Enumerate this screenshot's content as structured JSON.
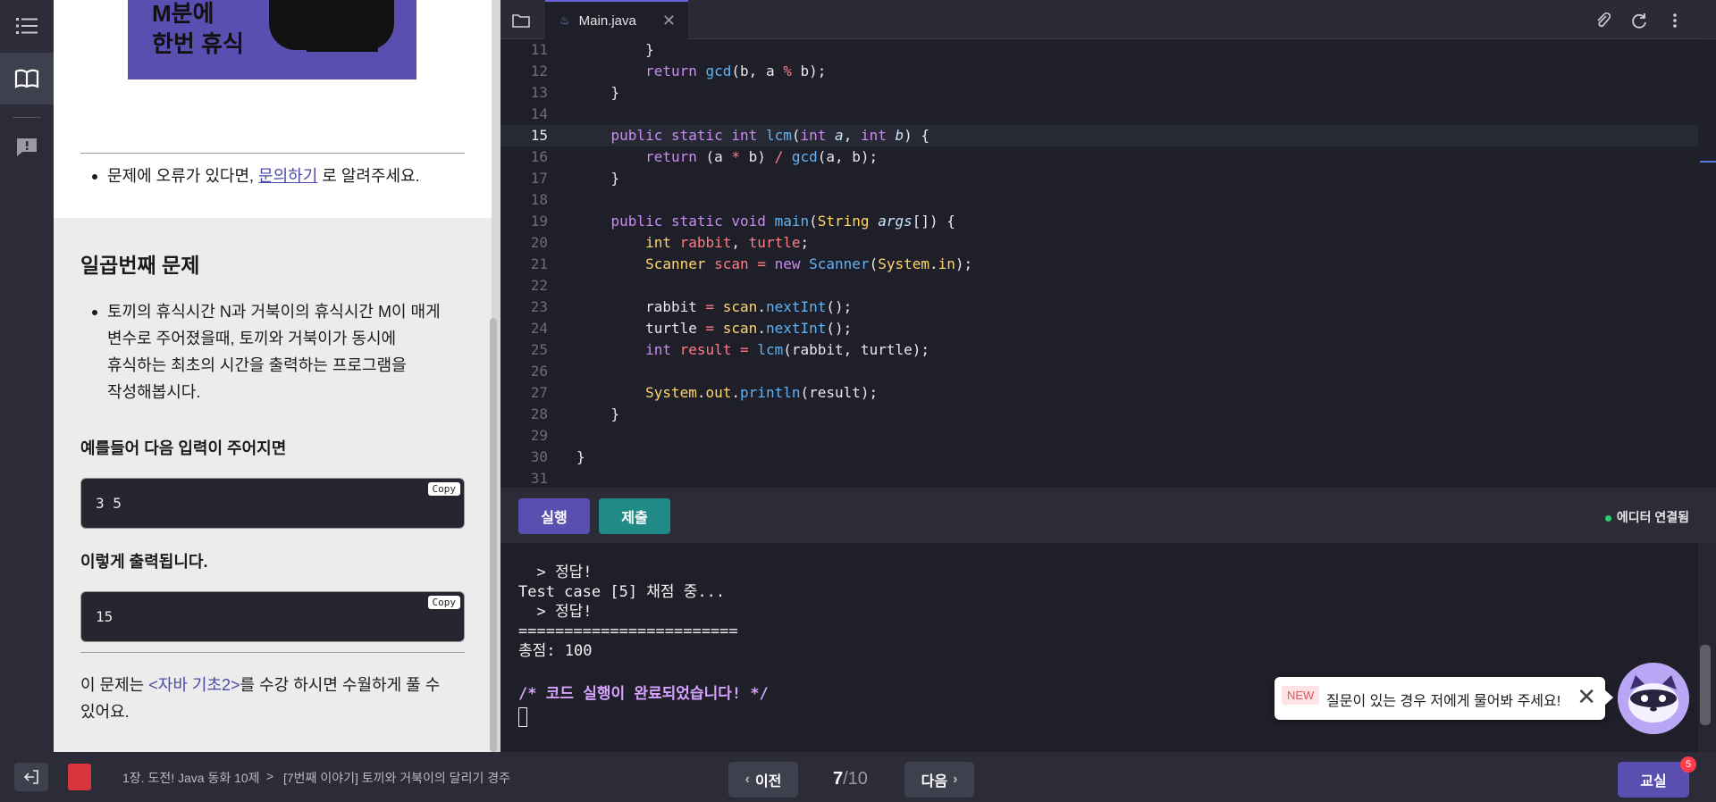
{
  "banner": {
    "text_line1": "M분에",
    "text_line2": "한번 휴식"
  },
  "panel": {
    "report_prefix": "문제에 오류가 있다면, ",
    "report_link": "문의하기",
    "report_suffix": " 로 알려주세요.",
    "section_title": "일곱번째 문제",
    "desc_line1": "토끼의 휴식시간 N과 거북이의 휴식시간 M이 매게",
    "desc_line2": "변수로 주어졌을때, 토끼와 거북이가 동시에",
    "desc_line3": "휴식하는 최초의 시간을 출력하는 프로그램을",
    "desc_line4": "작성해봅시다.",
    "input_heading": "예를들어 다음 입력이 주어지면",
    "input_value": "3 5",
    "output_heading": "이렇게 출력됩니다.",
    "output_value": "15",
    "copy_label": "Copy",
    "lecture_prefix": "이 문제는 ",
    "lecture_link": "<자바 기초2>",
    "lecture_suffix": "를 수강 하시면 수월하게 풀 수",
    "lecture_line2": "있어요."
  },
  "editor": {
    "tab_name": "Main.java",
    "tab_close": "✕",
    "line_numbers": [
      "11",
      "12",
      "13",
      "14",
      "15",
      "16",
      "17",
      "18",
      "19",
      "20",
      "21",
      "22",
      "23",
      "24",
      "25",
      "26",
      "27",
      "28",
      "29",
      "30",
      "31"
    ]
  },
  "actions": {
    "run_label": "실행",
    "submit_label": "제출",
    "status_text": "에디터 연결됨"
  },
  "console": {
    "lines": [
      "  > 정답!",
      "Test case [5] 채점 중...",
      "  > 정답!",
      "========================",
      "총점: 100",
      "",
      "/* 코드 실행이 완료되었습니다! */"
    ]
  },
  "chat": {
    "new_label": "NEW",
    "message": "질문이 있는 경우 저에게 물어봐 주세요!",
    "close": "✕"
  },
  "bottom": {
    "crumb_chapter": "1장. 도전! Java 동화 10제",
    "crumb_sep": ">",
    "crumb_lesson": "[7번째 이야기] 토끼와 거북이의 달리기 경주",
    "prev_label": "이전",
    "next_label": "다음",
    "page_current": "7",
    "page_total": "/10",
    "classroom_label": "교실",
    "classroom_badge": "5"
  },
  "colors": {
    "accent": "#5a4fb0",
    "submit": "#1f8a86",
    "status_dot": "#2ecc71"
  }
}
